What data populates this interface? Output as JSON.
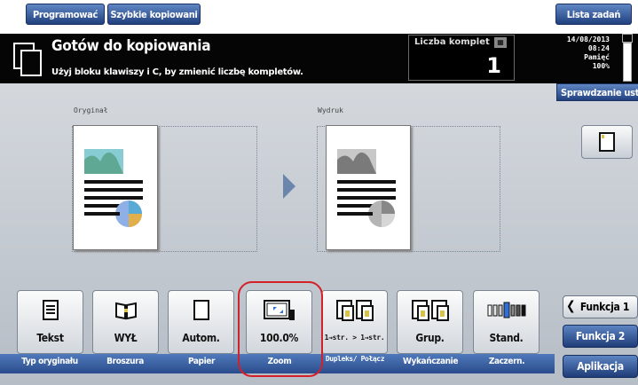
{
  "toolbar": {
    "programs_label": "Programować",
    "quick_copy_label": "Szybkie kopiowani",
    "job_list_label": "Lista zadań"
  },
  "status": {
    "title": "Gotów do kopiowania",
    "hint": "Użyj bloku klawiszy i C, by zmienić liczbę kompletów.",
    "sets_label": "Liczba komplet",
    "sets_value": "1",
    "date": "14/08/2013",
    "time": "08:24",
    "memory_label": "Pamięć",
    "memory_value": "100%"
  },
  "check_settings_label": "Sprawdzanie usta",
  "preview": {
    "original_label": "Oryginał",
    "output_label": "Wydruk"
  },
  "functions": [
    {
      "value": "Tekst",
      "caption": "Typ oryginału",
      "icon": "text-page-icon"
    },
    {
      "value": "WYŁ",
      "caption": "Broszura",
      "icon": "booklet-icon"
    },
    {
      "value": "Autom.",
      "caption": "Papier",
      "icon": "paper-icon"
    },
    {
      "value": "100.0%",
      "caption": "Zoom",
      "icon": "zoom-icon"
    },
    {
      "value": "1→str. > 1→str.",
      "caption": "Dupleks/ Połącz",
      "icon": "duplex-icon"
    },
    {
      "value": "Grup.",
      "caption": "Wykańczanie",
      "icon": "finishing-icon"
    },
    {
      "value": "Stand.",
      "caption": "Zaczern.",
      "icon": "density-icon"
    }
  ],
  "right_menu": {
    "function1": "Funkcja 1",
    "function2": "Funkcja 2",
    "application": "Aplikacja"
  },
  "colors": {
    "accent_blue": "#2b4c8c",
    "highlight_red": "#d3212a"
  }
}
